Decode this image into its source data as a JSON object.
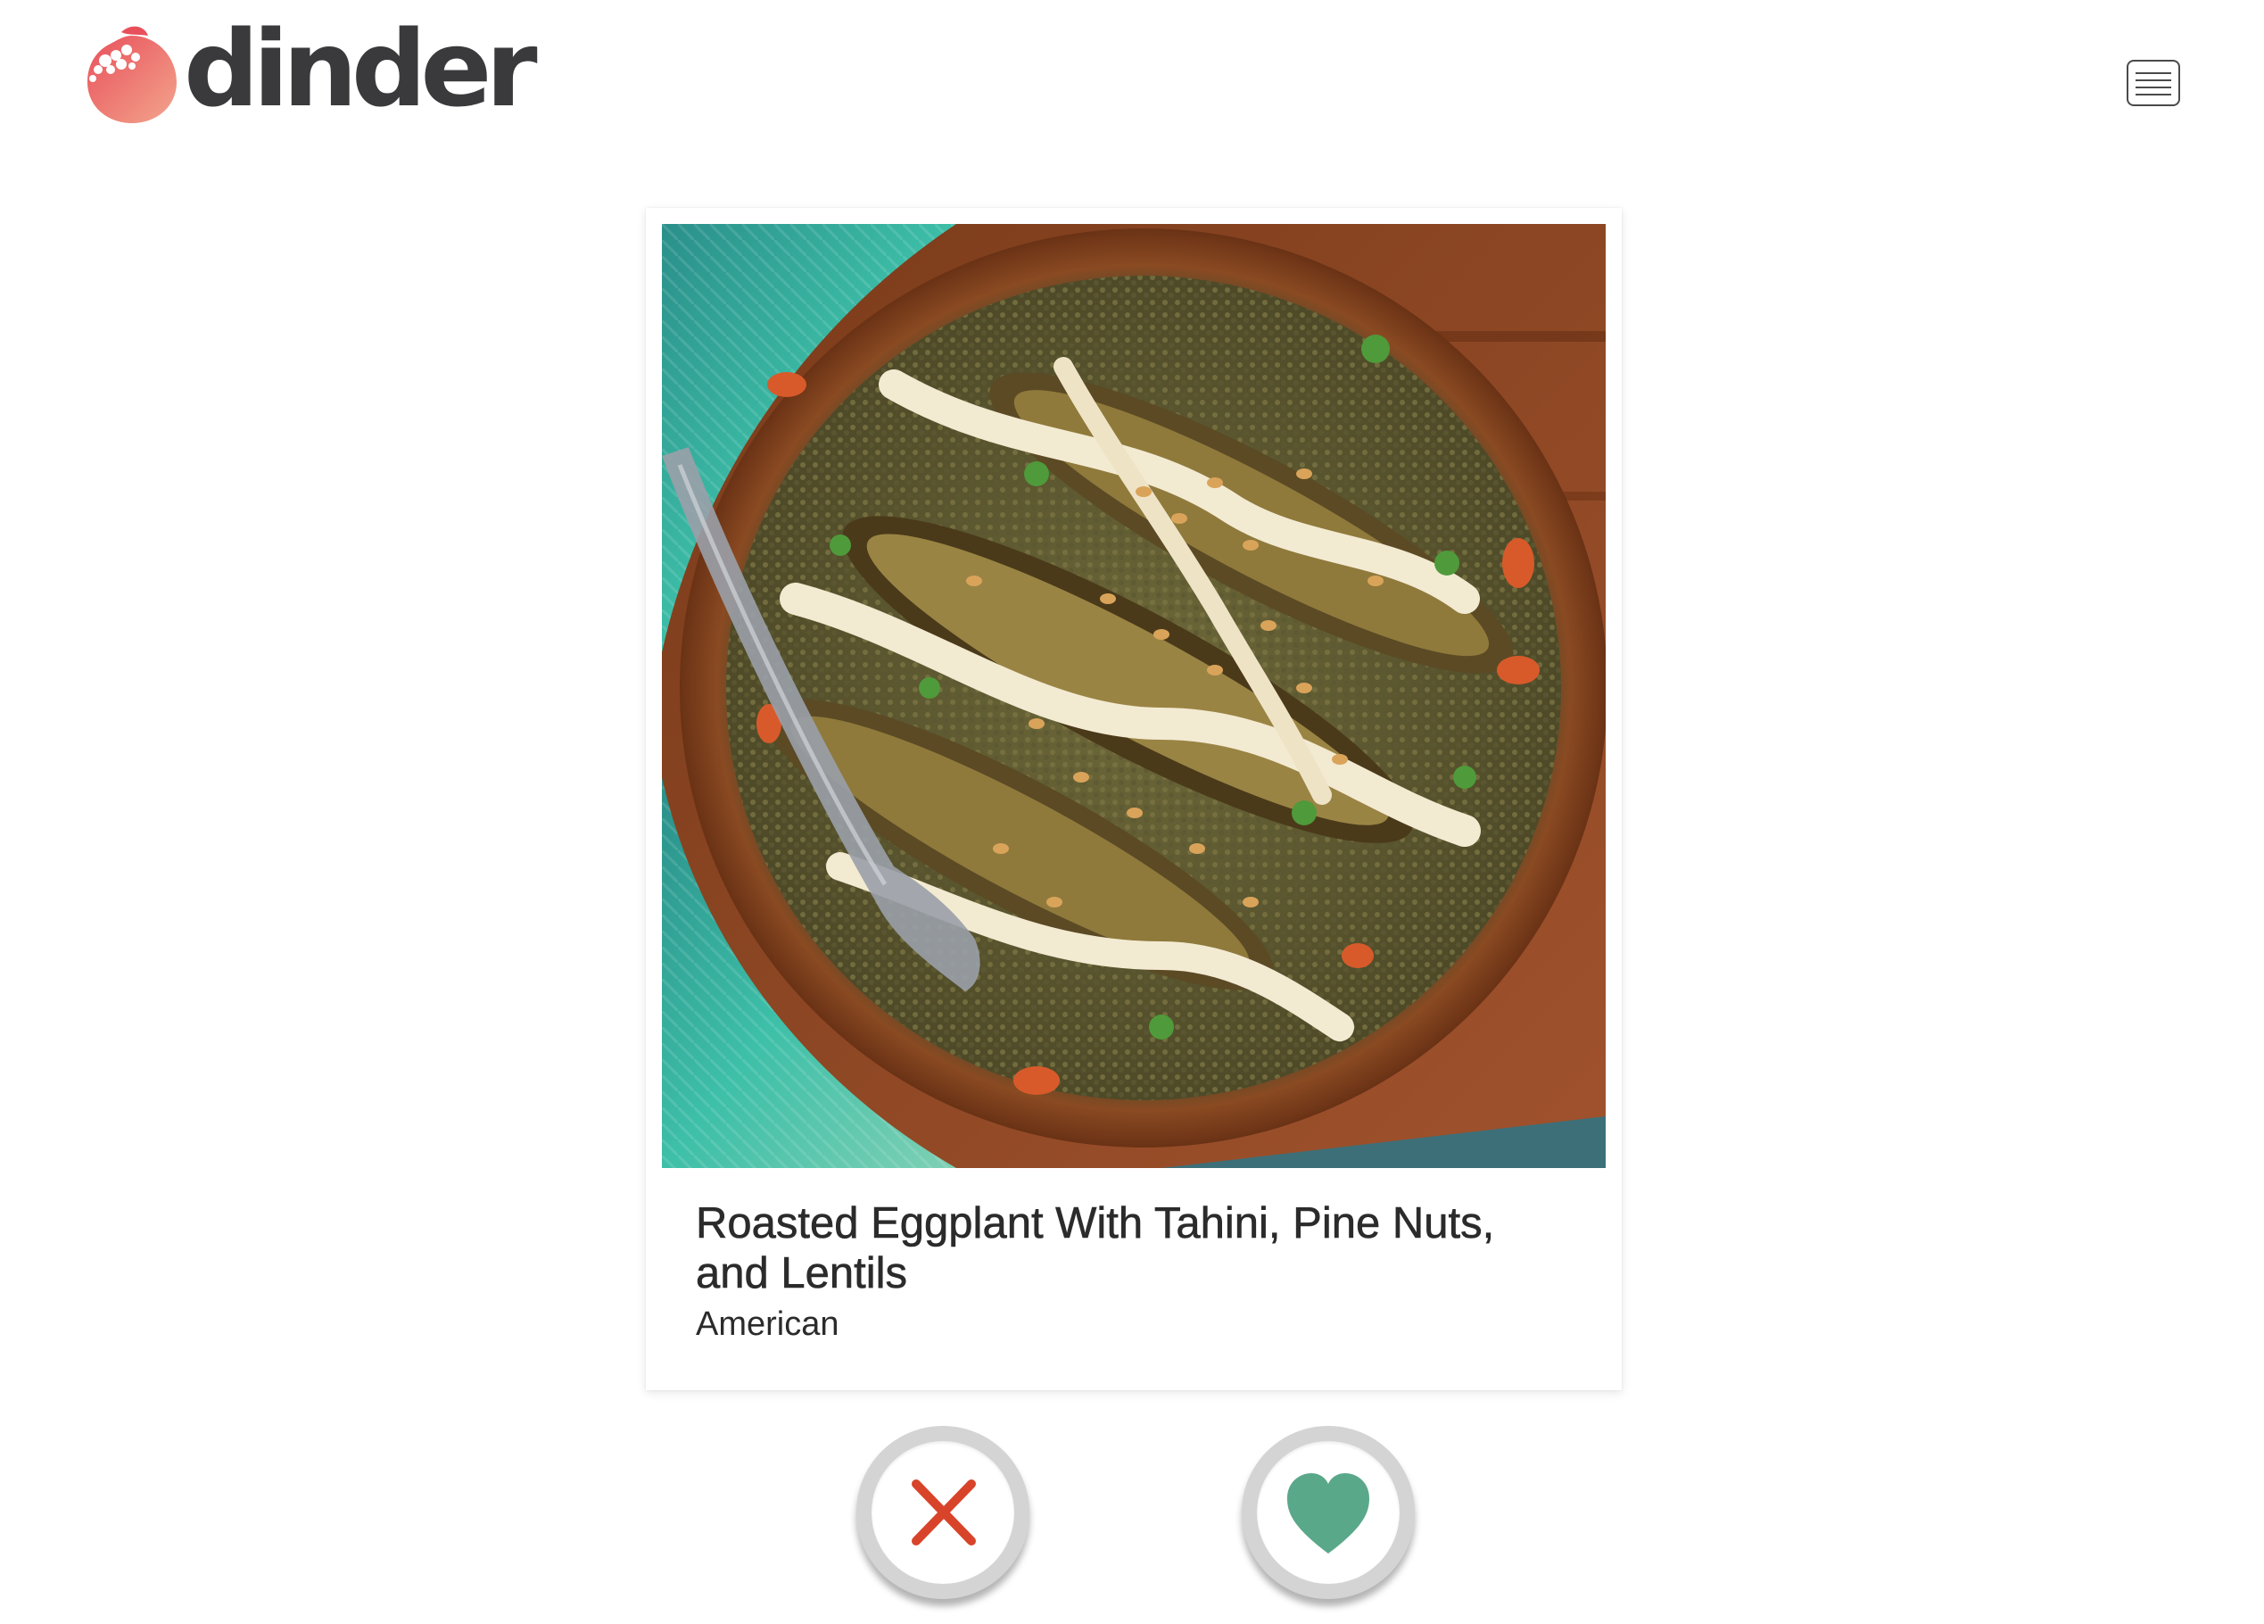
{
  "app": {
    "logo_text": "dinder"
  },
  "header": {
    "menu_icon": "hamburger-icon"
  },
  "recipe": {
    "title": "Roasted Eggplant With Tahini, Pine Nuts, and Lentils",
    "cuisine": "American",
    "image_icon": "food-photo"
  },
  "actions": {
    "dislike_icon": "x-icon",
    "like_icon": "heart-icon"
  },
  "colors": {
    "brand_gradient_start": "#e8505b",
    "brand_gradient_end": "#f29a86",
    "logo_text": "#3a3a3c",
    "dislike": "#d8442a",
    "like": "#5aa88a"
  }
}
